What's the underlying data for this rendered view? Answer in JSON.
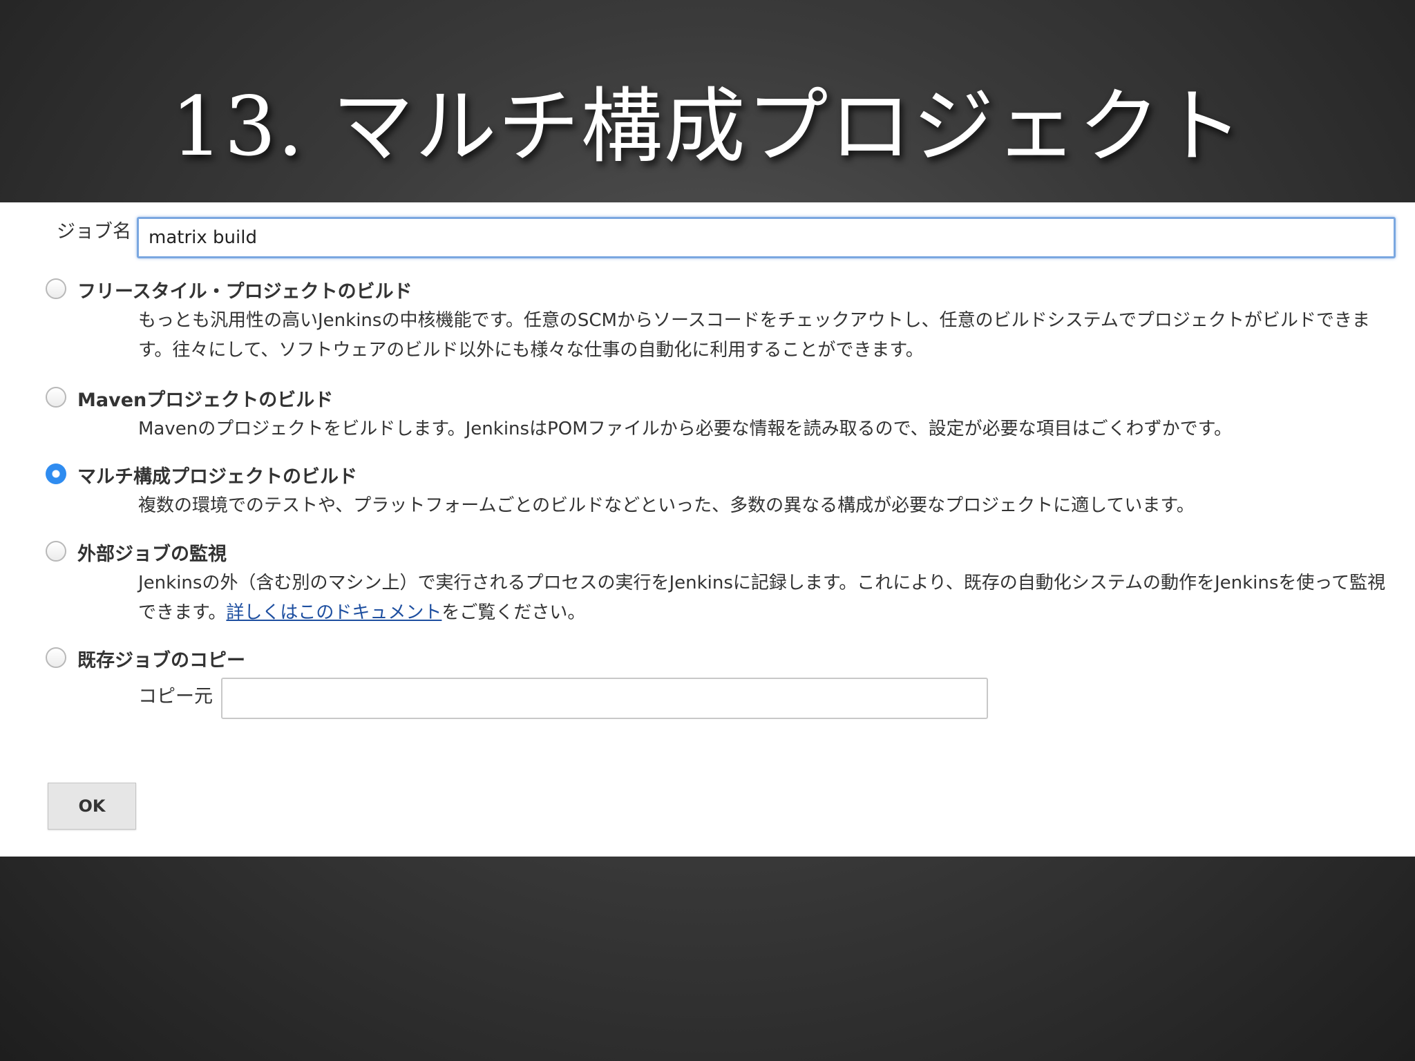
{
  "slide": {
    "title": "13. マルチ構成プロジェクト"
  },
  "form": {
    "job_name_label": "ジョブ名",
    "job_name_value": "matrix build",
    "options": [
      {
        "title": "フリースタイル・プロジェクトのビルド",
        "description": "もっとも汎用性の高いJenkinsの中核機能です。任意のSCMからソースコードをチェックアウトし、任意のビルドシステムでプロジェクトがビルドできます。往々にして、ソフトウェアのビルド以外にも様々な仕事の自動化に利用することができます。",
        "selected": false
      },
      {
        "title": "Mavenプロジェクトのビルド",
        "description": "Mavenのプロジェクトをビルドします。JenkinsはPOMファイルから必要な情報を読み取るので、設定が必要な項目はごくわずかです。",
        "selected": false
      },
      {
        "title": "マルチ構成プロジェクトのビルド",
        "description": "複数の環境でのテストや、プラットフォームごとのビルドなどといった、多数の異なる構成が必要なプロジェクトに適しています。",
        "selected": true
      },
      {
        "title": "外部ジョブの監視",
        "description_before": "Jenkinsの外（含む別のマシン上）で実行されるプロセスの実行をJenkinsに記録します。これにより、既存の自動化システムの動作をJenkinsを使って監視できます。",
        "link_text": "詳しくはこのドキュメント",
        "description_after": "をご覧ください。",
        "selected": false
      },
      {
        "title": "既存ジョブのコピー",
        "copy_from_label": "コピー元",
        "copy_from_value": "",
        "selected": false
      }
    ],
    "ok_label": "OK"
  },
  "colors": {
    "radio_selected": "#2f8cf0",
    "input_focus_border": "#7aa7e0",
    "link": "#1e4fa0"
  }
}
